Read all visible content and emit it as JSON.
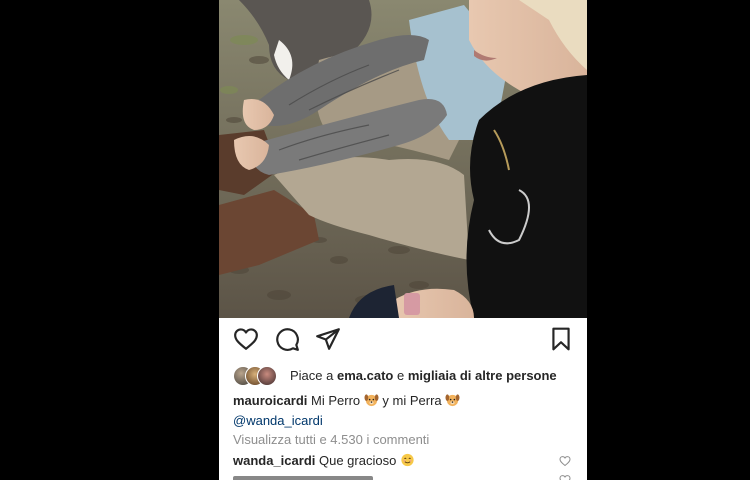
{
  "post": {
    "likes": {
      "prefix": "Piace a ",
      "user": "ema.cato",
      "middle": " e ",
      "others": "migliaia di altre persone"
    },
    "caption": {
      "username": "mauroicardi",
      "text_1": "Mi Perro",
      "text_2": "y mi Perra",
      "mention": "@wanda_icardi"
    },
    "view_all_comments": "Visualizza tutti e 4.530 i commenti",
    "comments": [
      {
        "username": "wanda_icardi",
        "text": "Que gracioso"
      }
    ],
    "icons": {
      "like": "heart-icon",
      "comment": "comment-icon",
      "share": "send-icon",
      "save": "bookmark-icon",
      "dog_emoji": "dog-face-emoji",
      "smile_emoji": "smiling-face-emoji"
    },
    "colors": {
      "text": "#262626",
      "muted": "#8e8e8e",
      "link": "#00376b",
      "background": "#000000"
    }
  }
}
